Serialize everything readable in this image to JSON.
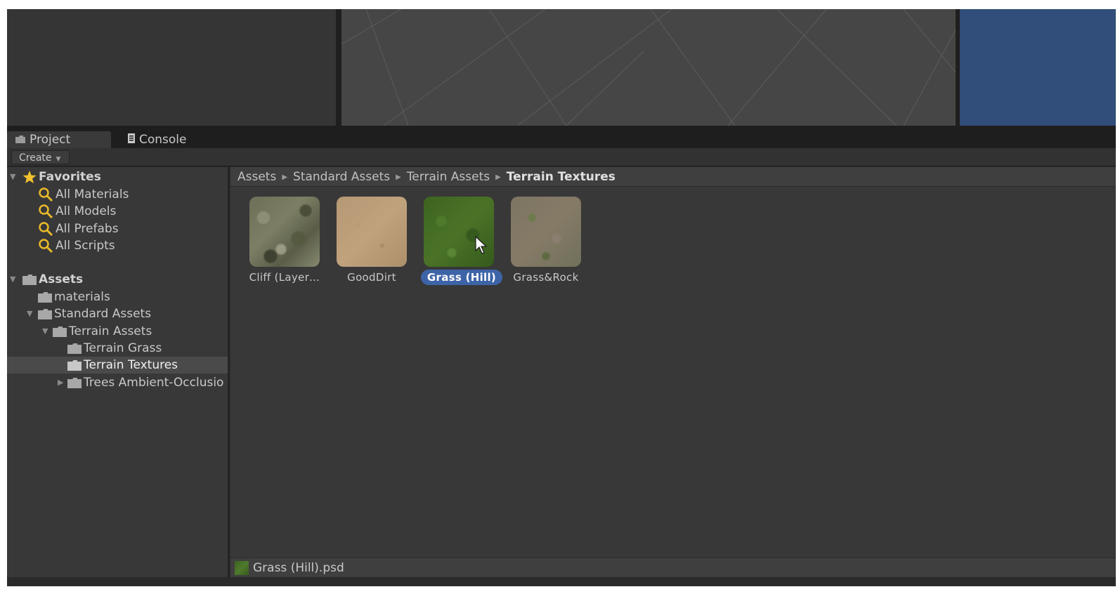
{
  "tabs": {
    "project_label": "Project",
    "console_label": "Console"
  },
  "toolbar": {
    "create_label": "Create"
  },
  "tree": {
    "favorites_label": "Favorites",
    "favorites_items": [
      "All Materials",
      "All Models",
      "All Prefabs",
      "All Scripts"
    ],
    "assets_label": "Assets",
    "folders": {
      "materials": "materials",
      "standard_assets": "Standard Assets",
      "terrain_assets": "Terrain Assets",
      "terrain_grass": "Terrain Grass",
      "terrain_textures": "Terrain Textures",
      "trees": "Trees Ambient-Occlusio"
    }
  },
  "breadcrumb": [
    "Assets",
    "Standard Assets",
    "Terrain Assets",
    "Terrain Textures"
  ],
  "assets": [
    {
      "label": "Cliff (Layer…",
      "icon": "cliff-texture"
    },
    {
      "label": "GoodDirt",
      "icon": "dirt-texture"
    },
    {
      "label": "Grass (Hill)",
      "icon": "grass-texture",
      "selected": true
    },
    {
      "label": "Grass&Rock",
      "icon": "grass-rock-texture"
    }
  ],
  "status": {
    "selected_file": "Grass (Hill).psd"
  },
  "colors": {
    "selection_blue": "#3e64a8",
    "favorites_star": "#f3c22f",
    "search_icon": "#e9b92a",
    "game_view": "#314d79"
  }
}
